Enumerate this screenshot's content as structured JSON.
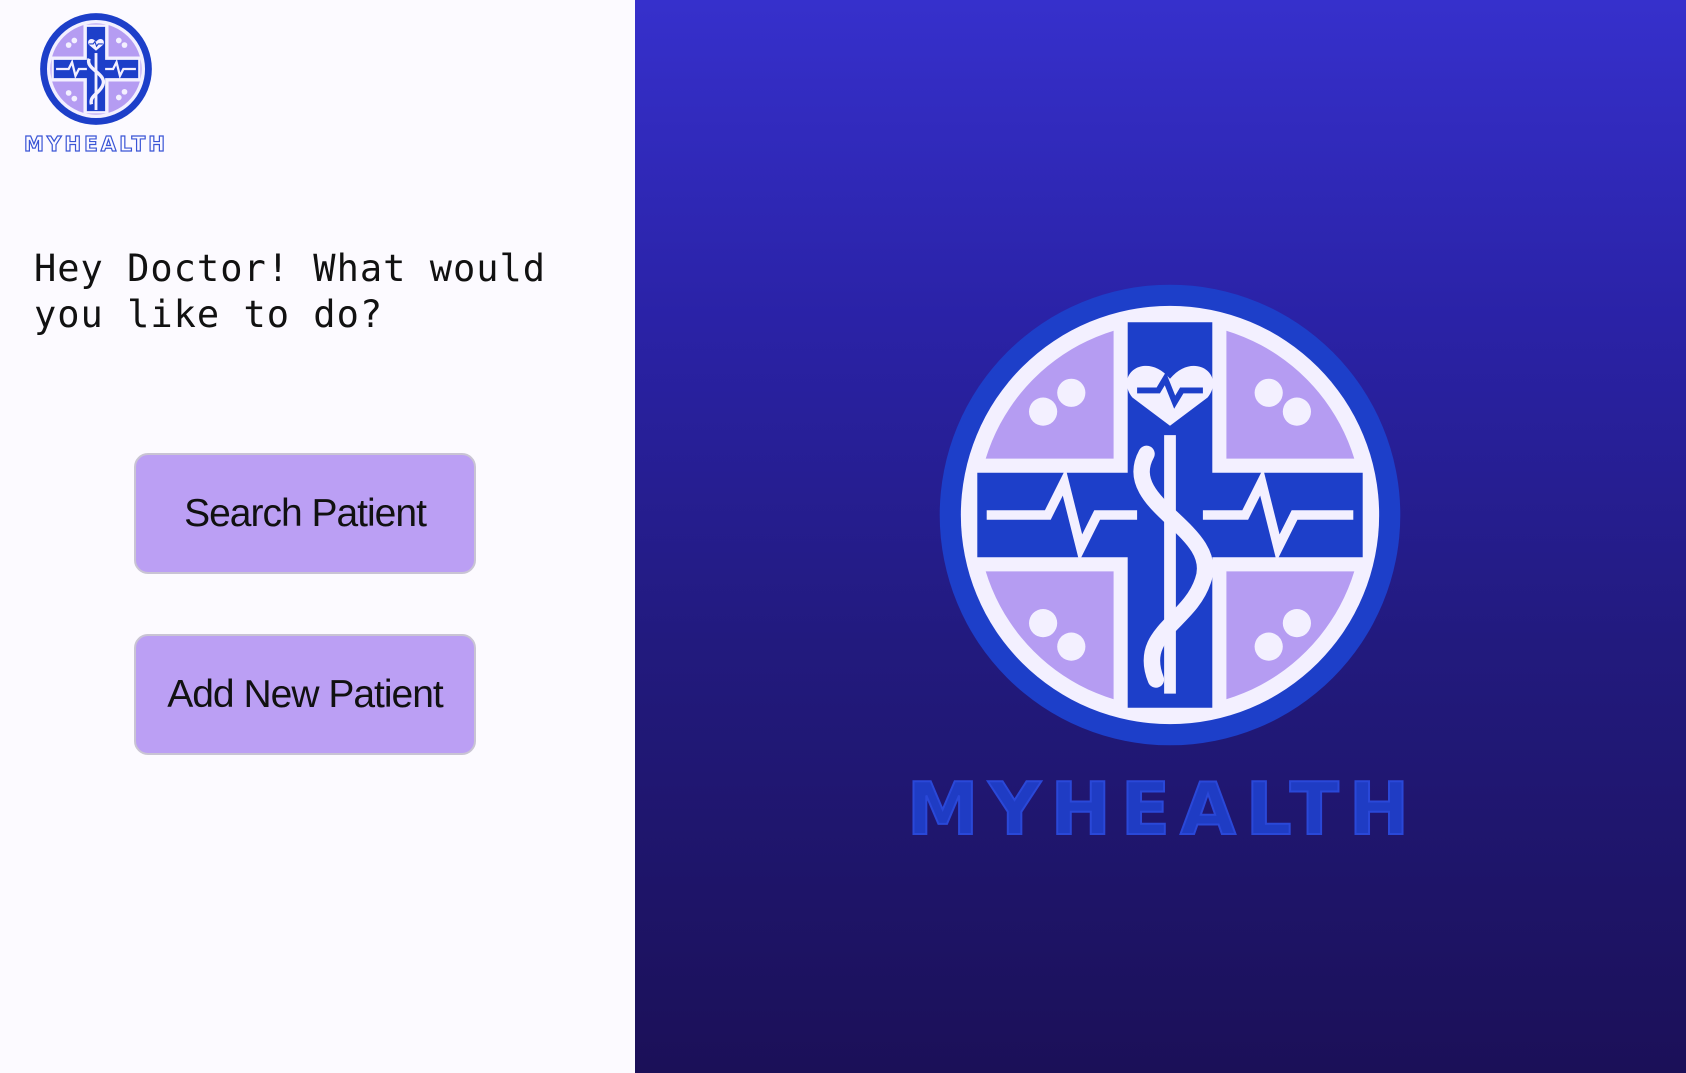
{
  "app": {
    "brand_name": "MYHEALTH"
  },
  "sidebar": {
    "logo_wordmark": "MYHEALTH",
    "greeting": "Hey Doctor! What would you like to do?",
    "buttons": {
      "search_label": "Search Patient",
      "add_label": "Add New Patient"
    }
  },
  "hero": {
    "wordmark": "MYHEALTH"
  },
  "colors": {
    "button_bg": "#bb9ff4",
    "brand_blue": "#1d3fc9",
    "brand_lavender": "#b59cf2",
    "hero_gradient_top": "#3630cc",
    "hero_gradient_bottom": "#1b1058"
  },
  "icons": {
    "logo": "caduceus-cross-heart-icon",
    "cursor": "mouse-pointer-icon"
  }
}
